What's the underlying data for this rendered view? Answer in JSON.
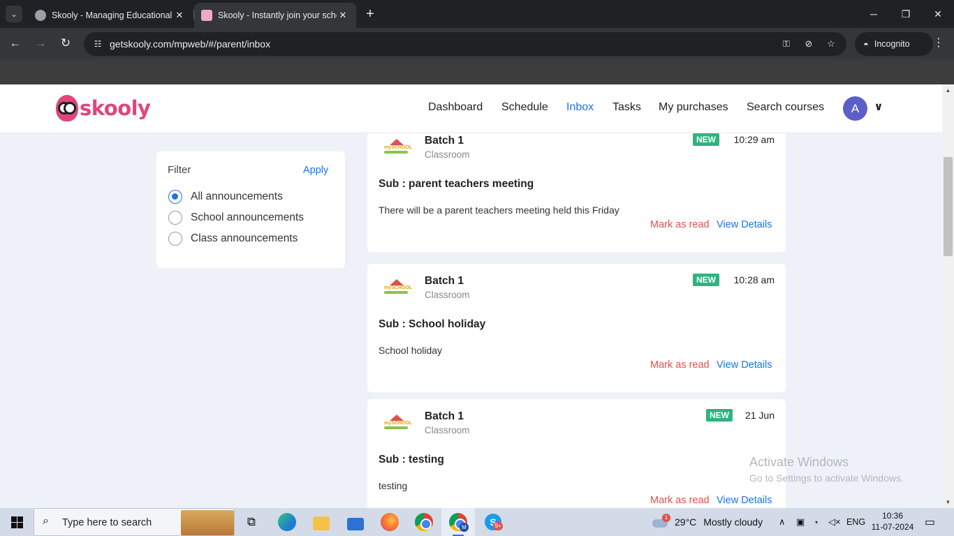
{
  "browser": {
    "tabs": [
      {
        "title": "Skooly - Managing Educational Institution",
        "close": "✕"
      },
      {
        "title": "Skooly - Instantly join your school",
        "close": "✕"
      }
    ],
    "new_tab": "+",
    "window_controls": {
      "minimize": "─",
      "restore": "❐",
      "close": "✕"
    },
    "url": "getskooly.com/mpweb/#/parent/inbox",
    "incognito_label": "Incognito"
  },
  "header": {
    "brand": "skooly",
    "nav": [
      "Dashboard",
      "Schedule",
      "Inbox",
      "Tasks",
      "My purchases",
      "Search courses"
    ],
    "active_nav": "Inbox",
    "avatar_initial": "A"
  },
  "filter": {
    "title": "Filter",
    "apply": "Apply",
    "options": [
      "All announcements",
      "School announcements",
      "Class announcements"
    ],
    "selected": "All announcements"
  },
  "announcements": [
    {
      "school_logo_text": "mySCHOOL",
      "batch": "Batch 1",
      "type": "Classroom",
      "badge": "NEW",
      "time": "10:29 am",
      "subject": "Sub : parent teachers meeting",
      "body": "There will be a parent teachers meeting held this Friday",
      "mark_as_read": "Mark as read",
      "view_details": "View Details"
    },
    {
      "school_logo_text": "mySCHOOL",
      "batch": "Batch 1",
      "type": "Classroom",
      "badge": "NEW",
      "time": "10:28 am",
      "subject": "Sub : School holiday",
      "body": "School holiday",
      "mark_as_read": "Mark as read",
      "view_details": "View Details"
    },
    {
      "school_logo_text": "mySCHOOL",
      "batch": "Batch 1",
      "type": "Classroom",
      "badge": "NEW",
      "time": "21 Jun",
      "subject": "Sub : testing",
      "body": "testing",
      "mark_as_read": "Mark as read",
      "view_details": "View Details"
    }
  ],
  "watermark": {
    "line1": "Activate Windows",
    "line2": "Go to Settings to activate Windows."
  },
  "taskbar": {
    "search_placeholder": "Type here to search",
    "weather_badge": "1",
    "temperature": "29°C",
    "weather": "Mostly cloudy",
    "language": "ENG",
    "time": "10:36",
    "date": "11-07-2024",
    "skype_badge": "9+",
    "chrome_profile": "M"
  },
  "colors": {
    "accent": "#1a73e8",
    "brand": "#e0457b",
    "badge_new": "#2fb380",
    "mark_as_read": "#e0524c",
    "page_bg": "#eef2f8"
  }
}
